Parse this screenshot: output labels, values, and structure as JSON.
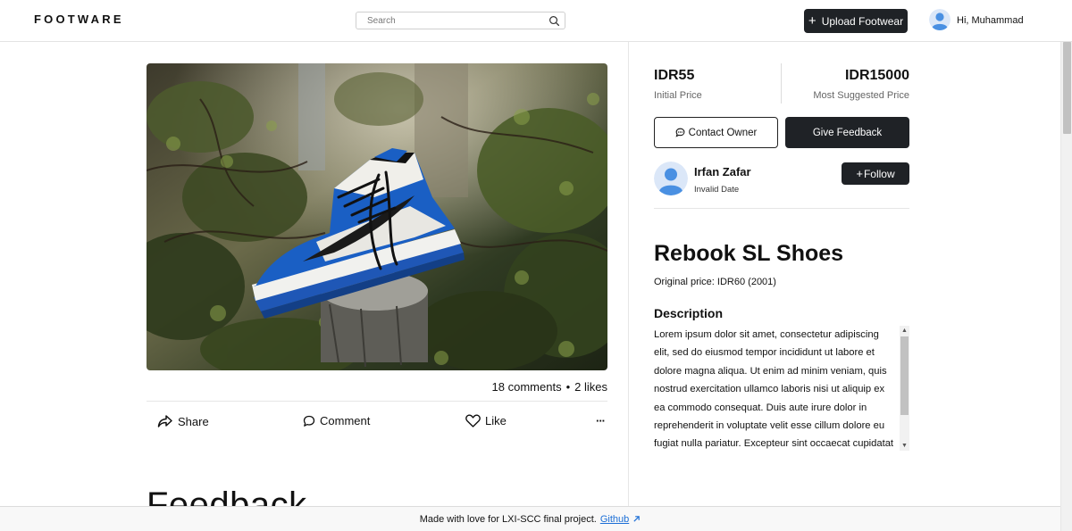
{
  "header": {
    "logo": "FOOTWARE",
    "search_placeholder": "Search",
    "upload_label": "Upload Footwear",
    "greeting": "Hi, Muhammad"
  },
  "post": {
    "comments": "18 comments",
    "likes": "2 likes",
    "actions": {
      "share": "Share",
      "comment": "Comment",
      "like": "Like",
      "more": "···"
    },
    "feedback_heading": "Feedback"
  },
  "pricing": {
    "initial_price": "IDR55",
    "initial_label": "Initial Price",
    "suggested_price": "IDR15000",
    "suggested_label": "Most Suggested Price"
  },
  "buttons": {
    "contact": "Contact Owner",
    "feedback": "Give Feedback",
    "follow": "Follow"
  },
  "owner": {
    "name": "Irfan Zafar",
    "date": "Invalid Date"
  },
  "product": {
    "title": "Rebook SL Shoes",
    "original_price_label": "Original price:",
    "original_price_value": "IDR60 (2001)",
    "description_heading": "Description",
    "description": "Lorem ipsum dolor sit amet, consectetur adipiscing elit, sed do eiusmod tempor incididunt ut labore et dolore magna aliqua. Ut enim ad minim veniam, quis nostrud exercitation ullamco laboris nisi ut aliquip ex ea commodo consequat. Duis aute irure dolor in reprehenderit in voluptate velit esse cillum dolore eu fugiat nulla pariatur. Excepteur sint occaecat cupidatat non proident, sunt in culpa qui officia deserunt mollit anim id est laborum."
  },
  "footer": {
    "text": "Made with love for LXI-SCC final project.",
    "link": "Github"
  },
  "colors": {
    "dark_button": "#1f2226",
    "avatar_blue": "#4a90e2",
    "link_blue": "#1b6ed6"
  }
}
